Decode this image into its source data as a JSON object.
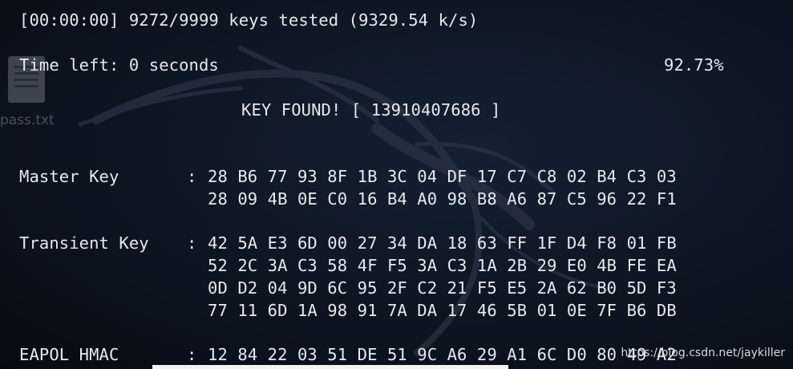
{
  "terminal": {
    "progress_line": "[00:00:00] 9272/9999 keys tested (9329.54 k/s)",
    "time_left_label": "Time left: 0 seconds",
    "percent": "92.73%",
    "key_found": "KEY FOUND! [ 13910407686 ]",
    "master_key": {
      "label": "Master Key",
      "sep": ":",
      "rows": [
        "28 B6 77 93 8F 1B 3C 04 DF 17 C7 C8 02 B4 C3 03",
        "28 09 4B 0E C0 16 B4 A0 98 B8 A6 87 C5 96 22 F1"
      ]
    },
    "transient_key": {
      "label": "Transient Key",
      "sep": ":",
      "rows": [
        "42 5A E3 6D 00 27 34 DA 18 63 FF 1F D4 F8 01 FB",
        "52 2C 3A C3 58 4F F5 3A C3 1A 2B 29 E0 4B FE EA",
        "0D D2 04 9D 6C 95 2F C2 21 F5 E5 2A 62 B0 5D F3",
        "77 11 6D 1A 98 91 7A DA 17 46 5B 01 0E 7F B6 DB"
      ]
    },
    "eapol_hmac": {
      "label": "EAPOL HMAC",
      "sep": ":",
      "rows": [
        "12 84 22 03 51 DE 51 9C A6 29 A1 6C D0 80 49 A2"
      ]
    }
  },
  "desktop": {
    "file_label": "pass.txt",
    "file_icon": "text-file-icon"
  },
  "watermark": "https://blog.csdn.net/jaykiller",
  "colors": {
    "background": "#0c1320",
    "text": "#e6e9ee"
  }
}
